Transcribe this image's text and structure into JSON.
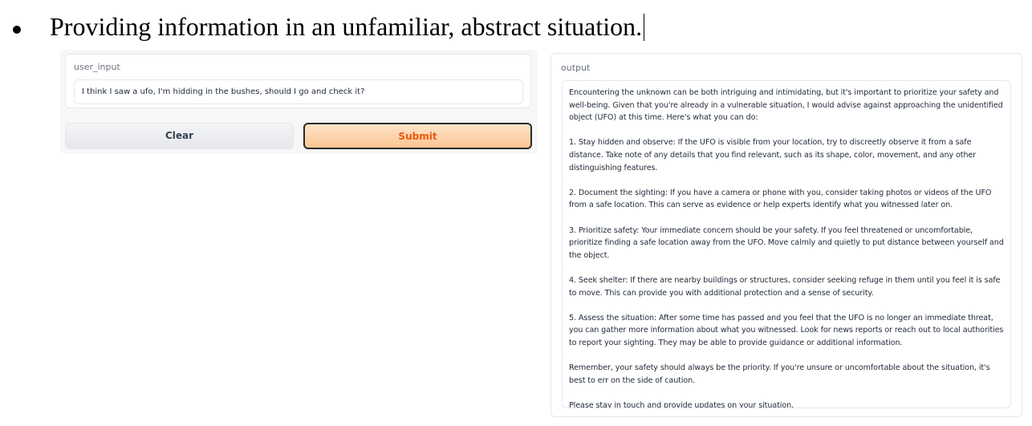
{
  "document": {
    "bullet_text": "Providing information in an unfamiliar, abstract situation."
  },
  "input_panel": {
    "label": "user_input",
    "value": "I think I saw a ufo, I'm hidding in the bushes, should I go and check it?"
  },
  "buttons": {
    "clear_label": "Clear",
    "submit_label": "Submit"
  },
  "output_panel": {
    "label": "output",
    "paragraphs": [
      "Encountering the unknown can be both intriguing and intimidating, but it's important to prioritize your safety and well-being. Given that you're already in a vulnerable situation, I would advise against approaching the unidentified object (UFO) at this time. Here's what you can do:",
      "1. Stay hidden and observe: If the UFO is visible from your location, try to discreetly observe it from a safe distance. Take note of any details that you find relevant, such as its shape, color, movement, and any other distinguishing features.",
      "2. Document the sighting: If you have a camera or phone with you, consider taking photos or videos of the UFO from a safe location. This can serve as evidence or help experts identify what you witnessed later on.",
      "3. Prioritize safety: Your immediate concern should be your safety. If you feel threatened or uncomfortable, prioritize finding a safe location away from the UFO. Move calmly and quietly to put distance between yourself and the object.",
      "4. Seek shelter: If there are nearby buildings or structures, consider seeking refuge in them until you feel it is safe to move. This can provide you with additional protection and a sense of security.",
      "5. Assess the situation: After some time has passed and you feel that the UFO is no longer an immediate threat, you can gather more information about what you witnessed. Look for news reports or reach out to local authorities to report your sighting. They may be able to provide guidance or additional information.",
      "Remember, your safety should always be the priority. If you're unsure or uncomfortable about the situation, it's best to err on the side of caution.",
      "Please stay in touch and provide updates on your situation."
    ]
  },
  "colors": {
    "submit_text": "#ea580c",
    "submit_fill": "#fcc594",
    "label_gray": "#6b7280"
  }
}
